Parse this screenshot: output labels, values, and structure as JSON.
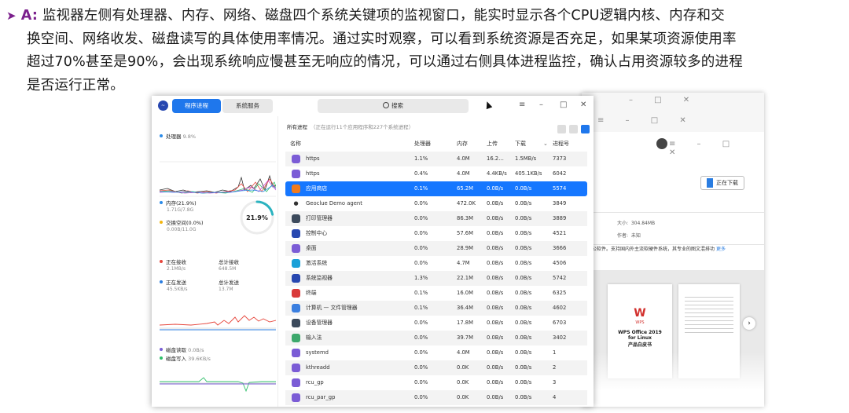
{
  "paragraph": {
    "bullet": "➤",
    "lead": "A:",
    "text1": "监视器左侧有处理器、内存、网络、磁盘四个系统关键项的监视窗口，能实时显示各个CPU逻辑内核、内存和交",
    "text2": "换空间、网络收发、磁盘读写的具体使用率情况。通过实时观察，可以看到系统资源是否充足，如果某项资源使用率",
    "text3": "超过70%甚至是90%，会出现系统响应慢甚至无响应的情况，可以通过右侧具体进程监控，确认占用资源较多的进程",
    "text4": "是否运行正常。"
  },
  "window": {
    "tabs": [
      "程序进程",
      "系统服务"
    ],
    "search_placeholder": "搜索",
    "controls": {
      "menu": "≡",
      "minimize": "–",
      "maximize": "□",
      "close": "✕"
    }
  },
  "left": {
    "cpu": {
      "label": "处理器",
      "value": "9.8%"
    },
    "memory": {
      "label": "内存(21.9%)",
      "detail": "1.71G/7.8G"
    },
    "swap": {
      "label": "交换空间(0.0%)",
      "detail": "0.00B/11.0G"
    },
    "gauge": {
      "text": "21.9%",
      "fraction": 0.219
    },
    "net": {
      "recv_label": "正在接收",
      "recv_value": "2.1MB/s",
      "recv_total_label": "总计接收",
      "recv_total_value": "648.5M",
      "send_label": "正在发送",
      "send_value": "45.5KB/s",
      "send_total_label": "总计发送",
      "send_total_value": "13.7M"
    },
    "disk": {
      "read_label": "磁盘读取",
      "read_value": "0.0B/s",
      "write_label": "磁盘写入",
      "write_value": "39.6KB/s"
    },
    "colors": {
      "cpu": "#2b8be8",
      "memory": "#2b8be8",
      "swap": "#f2b50f",
      "recv": "#e6463c",
      "send": "#2b7de0",
      "read": "#7a5fd6",
      "write": "#2fbf6a"
    }
  },
  "process": {
    "header_title": "所有进程",
    "header_sub": "（正在运行11个应用程序和227个系统进程）",
    "columns": [
      "名称",
      "处理器",
      "内存",
      "上传",
      "下载",
      "进程号"
    ],
    "rows": [
      {
        "name": "https",
        "cpu": "1.1%",
        "mem": "4.0M",
        "up": "16.2…",
        "down": "1.5MB/s",
        "pid": "7373",
        "icon": "purple"
      },
      {
        "name": "https",
        "cpu": "0.4%",
        "mem": "4.0M",
        "up": "4.4KB/s",
        "down": "405.1KB/s",
        "pid": "6042",
        "icon": "purple"
      },
      {
        "name": "应用商店",
        "cpu": "0.1%",
        "mem": "65.2M",
        "up": "0.0B/s",
        "down": "0.0B/s",
        "pid": "5574",
        "icon": "orange"
      },
      {
        "name": "Geoclue Demo agent",
        "cpu": "0.0%",
        "mem": "472.0K",
        "up": "0.0B/s",
        "down": "0.0B/s",
        "pid": "3849",
        "icon": "pin"
      },
      {
        "name": "打印管理器",
        "cpu": "0.0%",
        "mem": "86.3M",
        "up": "0.0B/s",
        "down": "0.0B/s",
        "pid": "3889",
        "icon": "dark"
      },
      {
        "name": "控制中心",
        "cpu": "0.0%",
        "mem": "57.6M",
        "up": "0.0B/s",
        "down": "0.0B/s",
        "pid": "4521",
        "icon": "navy"
      },
      {
        "name": "桌面",
        "cpu": "0.0%",
        "mem": "28.9M",
        "up": "0.0B/s",
        "down": "0.0B/s",
        "pid": "3666",
        "icon": "purple"
      },
      {
        "name": "激活系统",
        "cpu": "0.0%",
        "mem": "4.7M",
        "up": "0.0B/s",
        "down": "0.0B/s",
        "pid": "4506",
        "icon": "cyan"
      },
      {
        "name": "系统监视器",
        "cpu": "1.3%",
        "mem": "22.1M",
        "up": "0.0B/s",
        "down": "0.0B/s",
        "pid": "5742",
        "icon": "navy"
      },
      {
        "name": "终端",
        "cpu": "0.1%",
        "mem": "16.0M",
        "up": "0.0B/s",
        "down": "0.0B/s",
        "pid": "6325",
        "icon": "red"
      },
      {
        "name": "计算机 — 文件管理器",
        "cpu": "0.1%",
        "mem": "36.4M",
        "up": "0.0B/s",
        "down": "0.0B/s",
        "pid": "4602",
        "icon": "blue"
      },
      {
        "name": "设备管理器",
        "cpu": "0.0%",
        "mem": "17.8M",
        "up": "0.0B/s",
        "down": "0.0B/s",
        "pid": "6703",
        "icon": "dark"
      },
      {
        "name": "输入法",
        "cpu": "0.0%",
        "mem": "39.7M",
        "up": "0.0B/s",
        "down": "0.0B/s",
        "pid": "3402",
        "icon": "green"
      },
      {
        "name": "systemd",
        "cpu": "0.0%",
        "mem": "4.0M",
        "up": "0.0B/s",
        "down": "0.0B/s",
        "pid": "1",
        "icon": "purple"
      },
      {
        "name": "kthreadd",
        "cpu": "0.0%",
        "mem": "0.0K",
        "up": "0.0B/s",
        "down": "0.0B/s",
        "pid": "2",
        "icon": "purple"
      },
      {
        "name": "rcu_gp",
        "cpu": "0.0%",
        "mem": "0.0K",
        "up": "0.0B/s",
        "down": "0.0B/s",
        "pid": "3",
        "icon": "purple"
      },
      {
        "name": "rcu_par_gp",
        "cpu": "0.0%",
        "mem": "0.0K",
        "up": "0.0B/s",
        "down": "0.0B/s",
        "pid": "4",
        "icon": "purple"
      }
    ],
    "selected_index": 2
  },
  "background_window": {
    "download_button": "正在下载",
    "size_label": "大小:",
    "size_value": "304.84MB",
    "author_label": "作者:",
    "author_value": "未知",
    "description": "办公软件。支持国内外主流软硬件系统，其专业的图文混排功",
    "more_link": "更多",
    "doc_brand": "WPS",
    "doc_title": "WPS Office 2019",
    "doc_sub": "for Linux",
    "doc_caption": "产品白皮书"
  }
}
